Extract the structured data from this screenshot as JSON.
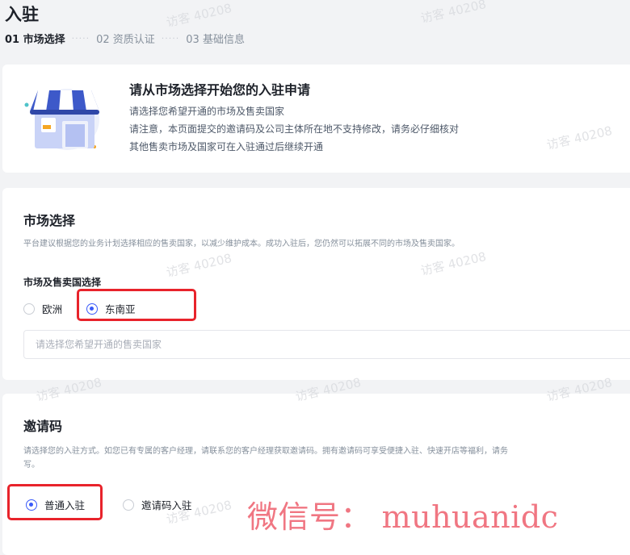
{
  "page": {
    "title": "入驻"
  },
  "steps": [
    {
      "label": "01 市场选择",
      "active": true
    },
    {
      "label": "02 资质认证",
      "active": false
    },
    {
      "label": "03 基础信息",
      "active": false
    }
  ],
  "step_separator": "·····",
  "banner": {
    "title": "请从市场选择开始您的入驻申请",
    "lines": [
      "请选择您希望开通的市场及售卖国家",
      "请注意，本页面提交的邀请码及公司主体所在地不支持修改，请务必仔细核对",
      "其他售卖市场及国家可在入驻通过后继续开通"
    ],
    "illustration_icon": "storefront-icon"
  },
  "market": {
    "title": "市场选择",
    "desc": "平台建议根据您的业务计划选择相应的售卖国家，以减少维护成本。成功入驻后，您仍然可以拓展不同的市场及售卖国家。",
    "field_label": "市场及售卖国选择",
    "options": [
      {
        "label": "欧洲",
        "checked": false
      },
      {
        "label": "东南亚",
        "checked": true
      }
    ],
    "country_placeholder": "请选择您希望开通的售卖国家"
  },
  "invite": {
    "title": "邀请码",
    "desc": "请选择您的入驻方式。如您已有专属的客户经理，请联系您的客户经理获取邀请码。拥有邀请码可享受便捷入驻、快速开店等福利，请务",
    "desc2": "写。",
    "options": [
      {
        "label": "普通入驻",
        "checked": true
      },
      {
        "label": "邀请码入驻",
        "checked": false
      }
    ]
  },
  "watermark": "访客 40208",
  "overlay_text": "微信号： muhuanidc",
  "colors": {
    "accent": "#3a5af9",
    "highlight": "#e8232b",
    "overlay": "#f07682"
  }
}
